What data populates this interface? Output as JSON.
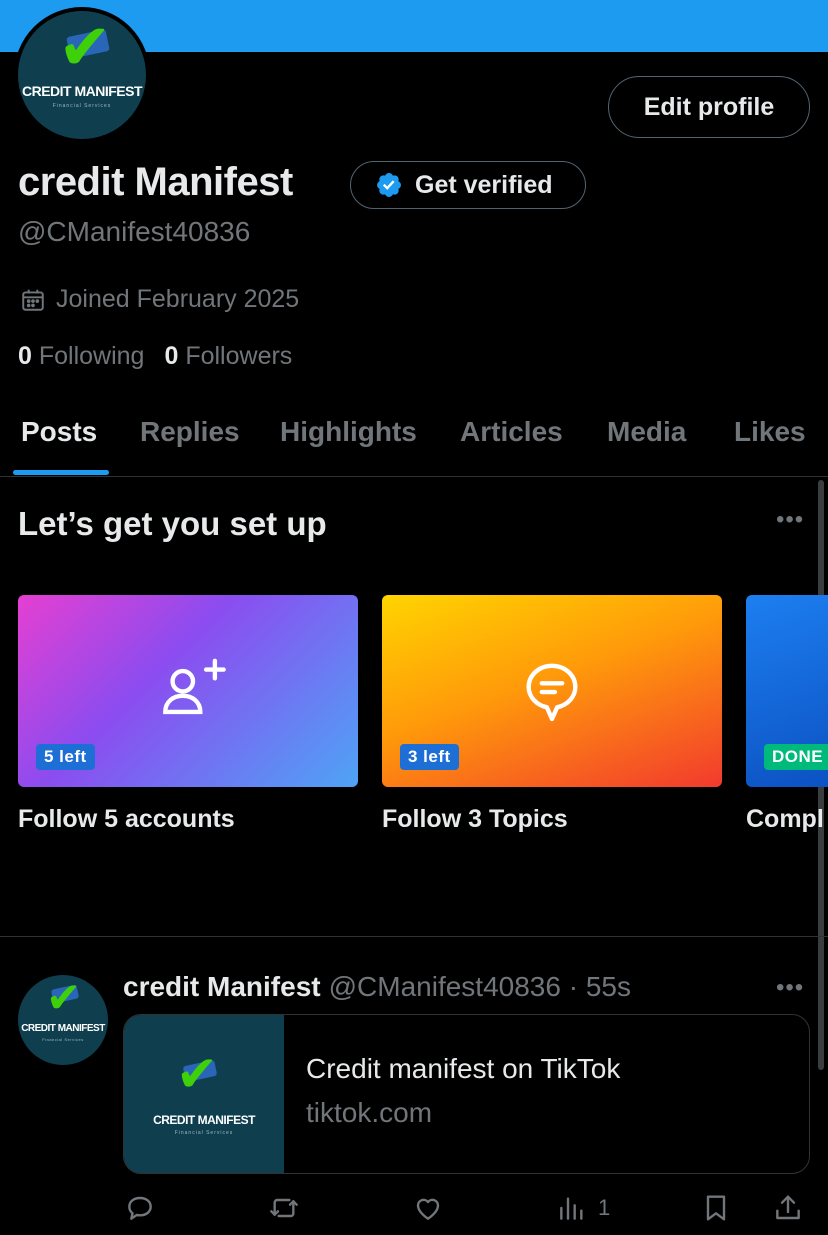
{
  "profile": {
    "display_name": "credit Manifest",
    "handle": "@CManifest40836",
    "joined": "Joined February 2025",
    "following_count": "0",
    "following_label": "Following",
    "followers_count": "0",
    "followers_label": "Followers",
    "edit_profile_label": "Edit profile",
    "get_verified_label": "Get verified",
    "logo": {
      "text": "CREDIT MANIFEST",
      "sub": "Financial Services"
    }
  },
  "tabs": [
    {
      "label": "Posts",
      "active": true
    },
    {
      "label": "Replies"
    },
    {
      "label": "Highlights"
    },
    {
      "label": "Articles"
    },
    {
      "label": "Media"
    },
    {
      "label": "Likes"
    }
  ],
  "setup": {
    "title": "Let’s get you set up",
    "more_label": "•••",
    "cards": [
      {
        "badge": "5 left",
        "label": "Follow 5 accounts",
        "icon": "person-add-icon"
      },
      {
        "badge": "3 left",
        "label": "Follow 3 Topics",
        "icon": "topic-bubble-icon"
      },
      {
        "badge": "DONE",
        "label": "Compl"
      }
    ]
  },
  "post": {
    "author": "credit Manifest",
    "meta": "@CManifest40836 · 55s",
    "more_label": "•••",
    "link_title": "Credit manifest on TikTok",
    "link_domain": "tiktok.com",
    "views": "1"
  },
  "colors": {
    "accent": "#1d9bf0",
    "background": "#000000",
    "muted": "#71767b",
    "done_green": "#00ba7c"
  }
}
